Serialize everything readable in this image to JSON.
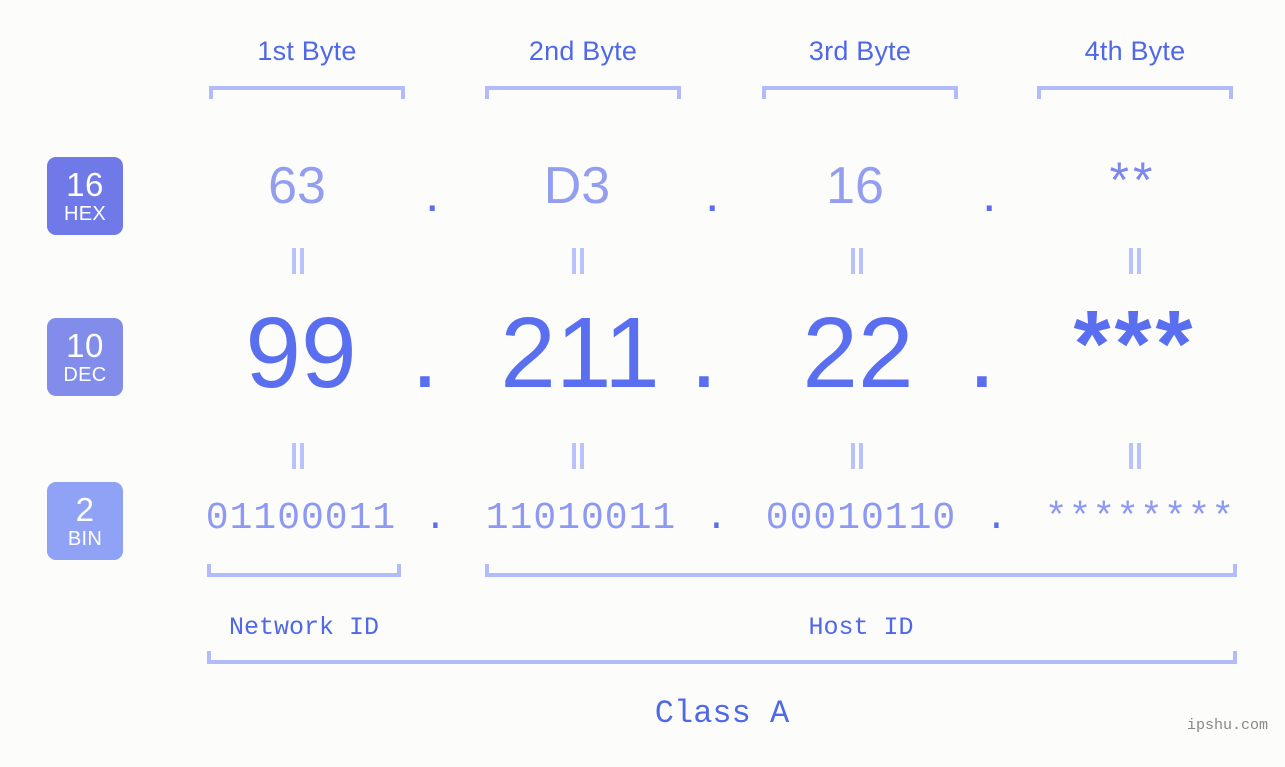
{
  "background_color": "#fcfdfa",
  "accent_color": "#5a6ef0",
  "bracket_color": "#b3bcfa",
  "byte_headers": [
    {
      "label": "1st Byte"
    },
    {
      "label": "2nd Byte"
    },
    {
      "label": "3rd Byte"
    },
    {
      "label": "4th Byte"
    }
  ],
  "radix_badges": [
    {
      "number": "16",
      "name": "HEX",
      "color": "#7079e8"
    },
    {
      "number": "10",
      "name": "DEC",
      "color": "#818ceb"
    },
    {
      "number": "2",
      "name": "BIN",
      "color": "#8fa2f5"
    }
  ],
  "rows": {
    "hex": {
      "values": [
        "63",
        "D3",
        "16",
        "**"
      ],
      "separator": "."
    },
    "dec": {
      "values": [
        "99",
        "211",
        "22",
        "***"
      ],
      "separator": "."
    },
    "bin": {
      "values": [
        "01100011",
        "11010011",
        "00010110",
        "********"
      ],
      "separator": "."
    }
  },
  "equivalence_mark": "=",
  "segments": {
    "network_id": "Network ID",
    "host_id": "Host ID",
    "class": "Class A"
  },
  "watermark": "ipshu.com"
}
